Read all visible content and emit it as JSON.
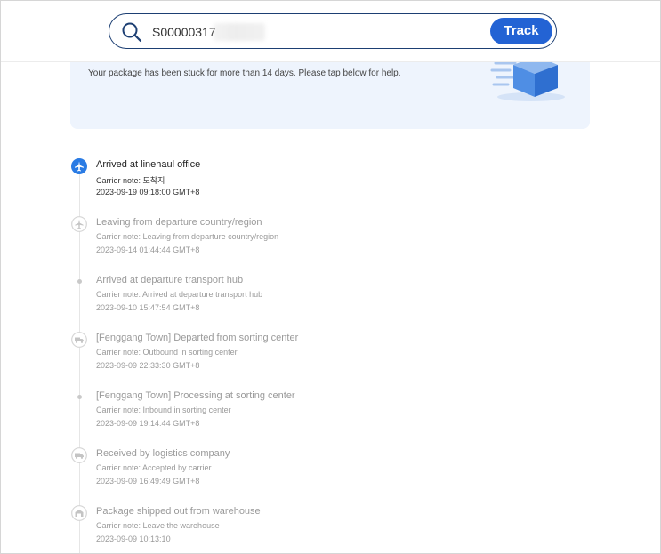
{
  "search": {
    "value": "S00000317",
    "track_label": "Track"
  },
  "alert": {
    "text": "Your package has been stuck for more than 14 days. Please tap below for help."
  },
  "events": [
    {
      "title": "Arrived at linehaul office",
      "note": "Carrier note: 도착지",
      "time": "2023-09-19 09:18:00 GMT+8",
      "icon": "airplane-icon",
      "active": true
    },
    {
      "title": "Leaving from departure country/region",
      "note": "Carrier note: Leaving from departure country/region",
      "time": "2023-09-14 01:44:44 GMT+8",
      "icon": "airplane-icon",
      "active": false
    },
    {
      "title": "Arrived at departure transport hub",
      "note": "Carrier note: Arrived at departure transport hub",
      "time": "2023-09-10 15:47:54 GMT+8",
      "icon": "dot-icon",
      "active": false
    },
    {
      "title": "[Fenggang Town] Departed from sorting center",
      "note": "Carrier note: Outbound in sorting center",
      "time": "2023-09-09 22:33:30 GMT+8",
      "icon": "truck-icon",
      "active": false
    },
    {
      "title": "[Fenggang Town] Processing at sorting center",
      "note": "Carrier note: Inbound in sorting center",
      "time": "2023-09-09 19:14:44 GMT+8",
      "icon": "dot-icon",
      "active": false
    },
    {
      "title": "Received by logistics company",
      "note": "Carrier note: Accepted by carrier",
      "time": "2023-09-09 16:49:49 GMT+8",
      "icon": "truck-icon",
      "active": false
    },
    {
      "title": "Package shipped out from warehouse",
      "note": "Carrier note: Leave the warehouse",
      "time": "2023-09-09 10:13:10",
      "icon": "warehouse-icon",
      "active": false
    }
  ],
  "colors": {
    "accent": "#2363d4",
    "active_icon": "#2a7be4",
    "inactive": "#9a9a9a",
    "card_bg": "#eef4fd"
  }
}
